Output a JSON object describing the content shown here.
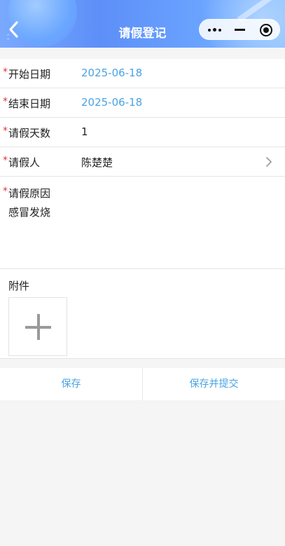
{
  "header": {
    "title": "请假登记",
    "icons": {
      "back": "chevron-left-icon",
      "more": "more-dots-icon",
      "minimize": "minimize-icon",
      "close": "target-circle-icon"
    }
  },
  "form": {
    "required_mark": "*",
    "fields": [
      {
        "label": "开始日期",
        "value": "2025-06-18"
      },
      {
        "label": "结束日期",
        "value": "2025-06-18"
      },
      {
        "label": "请假天数",
        "value": "1"
      },
      {
        "label": "请假人",
        "value": "陈楚楚"
      }
    ],
    "reason": {
      "label": "请假原因",
      "value": "感冒发烧"
    },
    "attachment": {
      "label": "附件"
    }
  },
  "actions": {
    "save": "保存",
    "save_submit": "保存并提交"
  },
  "colors": {
    "accent": "#4aa3e4",
    "required": "#e3343a",
    "header": "#5d8ff8"
  }
}
